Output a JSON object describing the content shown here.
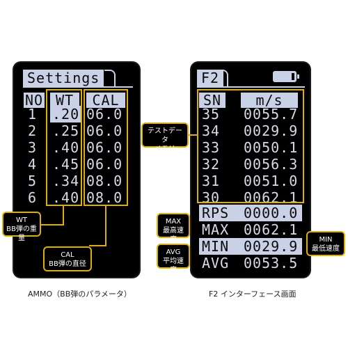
{
  "ammo": {
    "title": "Settings",
    "headers": {
      "no": "NO",
      "wt": "WT",
      "cal": "CAL"
    },
    "rows": [
      {
        "no": "1",
        "wt": ".20",
        "cal": "06.0"
      },
      {
        "no": "2",
        "wt": ".25",
        "cal": "06.0"
      },
      {
        "no": "3",
        "wt": ".40",
        "cal": "06.0"
      },
      {
        "no": "4",
        "wt": ".45",
        "cal": "06.0"
      },
      {
        "no": "5",
        "wt": ".34",
        "cal": "08.0"
      },
      {
        "no": "6",
        "wt": ".40",
        "cal": "08.0"
      }
    ],
    "caption": "AMMO（BB弾のパラメータ）"
  },
  "f2": {
    "title": "F2",
    "headers": {
      "sn": "SN",
      "ms": "m/s"
    },
    "rows": [
      {
        "sn": "35",
        "ms": "0055.7"
      },
      {
        "sn": "34",
        "ms": "0029.9"
      },
      {
        "sn": "33",
        "ms": "0050.1"
      },
      {
        "sn": "32",
        "ms": "0056.3"
      },
      {
        "sn": "31",
        "ms": "0051.0"
      },
      {
        "sn": "30",
        "ms": "0062.1"
      }
    ],
    "stats": {
      "rps": {
        "label": "RPS",
        "value": "0000.0"
      },
      "max": {
        "label": "MAX",
        "value": "0062.1"
      },
      "min": {
        "label": "MIN",
        "value": "0029.9"
      },
      "avg": {
        "label": "AVG",
        "value": "0053.5"
      }
    },
    "caption": "F2 インターフェース画面"
  },
  "callouts": {
    "wt": {
      "line1": "WT",
      "line2": "BB弾の重量"
    },
    "cal": {
      "line1": "CAL",
      "line2": "BB弾の直径"
    },
    "test_data": {
      "line1": "テストデータ",
      "line2": "メモリ"
    },
    "max": {
      "line1": "MAX",
      "line2": "最高速度"
    },
    "avg": {
      "line1": "AVG",
      "line2": "平均速度"
    },
    "min": {
      "line1": "MIN",
      "line2": "最低速度"
    }
  },
  "colors": {
    "lcd_highlight": "#c9d1e6",
    "callout_border": "#e0b000",
    "screen": "#000000"
  },
  "icons": {
    "battery": "battery-icon"
  }
}
